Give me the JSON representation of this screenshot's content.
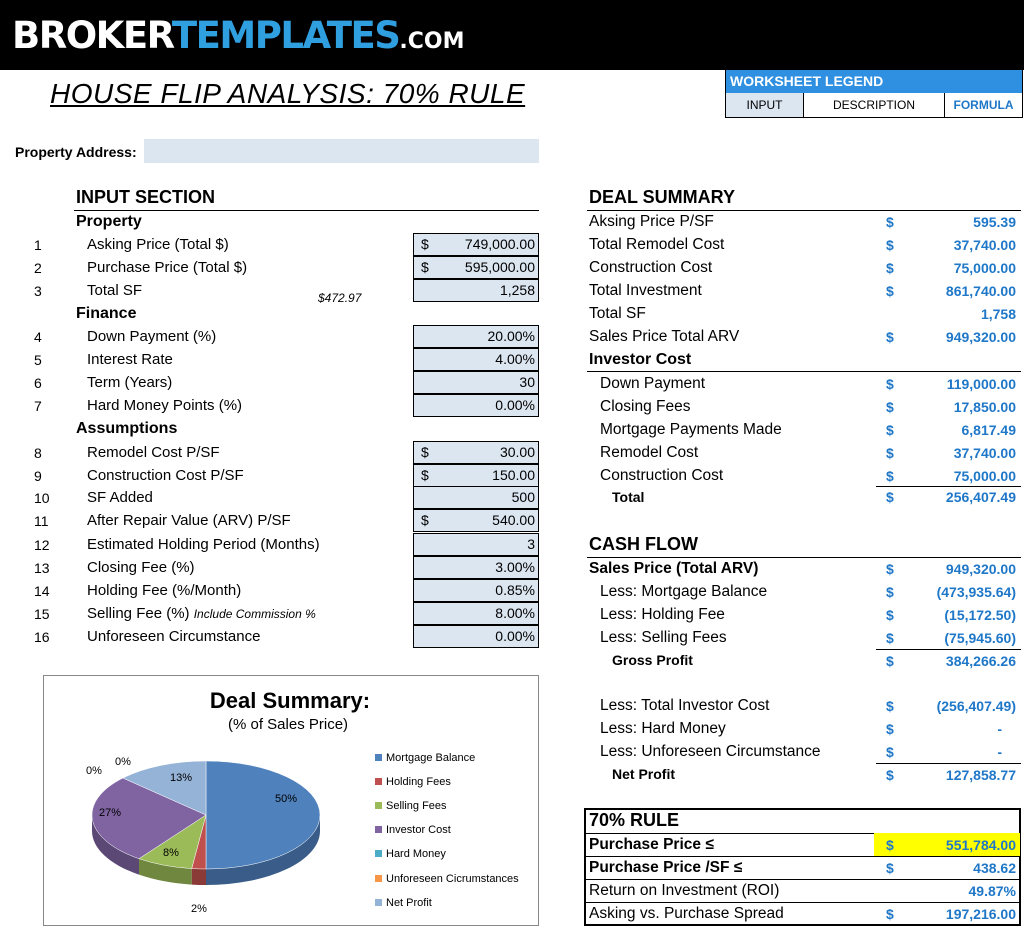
{
  "brand": {
    "part1": "BROKER",
    "part2": "TEMPLATES",
    "part3": ".COM"
  },
  "page_title": "HOUSE FLIP ANALYSIS: 70% RULE",
  "legend": {
    "title": "WORKSHEET LEGEND",
    "input": "INPUT",
    "description": "DESCRIPTION",
    "formula": "FORMULA"
  },
  "property_address": {
    "label": "Property Address:",
    "value": ""
  },
  "input_section": {
    "title": "INPUT SECTION",
    "sub_property": "Property",
    "sub_finance": "Finance",
    "sub_assumptions": "Assumptions",
    "purchase_per_sf_note": "$472.97",
    "rows": [
      {
        "num": "1",
        "label": "Asking Price (Total $)",
        "note": "",
        "currency": "$",
        "value": "749,000.00"
      },
      {
        "num": "2",
        "label": "Purchase Price (Total $)",
        "note": "",
        "currency": "$",
        "value": "595,000.00"
      },
      {
        "num": "3",
        "label": "Total SF",
        "note": "",
        "currency": "",
        "value": "1,258"
      },
      {
        "num": "4",
        "label": "Down Payment (%)",
        "note": "",
        "currency": "",
        "value": "20.00%"
      },
      {
        "num": "5",
        "label": "Interest Rate",
        "note": "",
        "currency": "",
        "value": "4.00%"
      },
      {
        "num": "6",
        "label": "Term (Years)",
        "note": "",
        "currency": "",
        "value": "30"
      },
      {
        "num": "7",
        "label": "Hard Money Points (%)",
        "note": "",
        "currency": "",
        "value": "0.00%"
      },
      {
        "num": "8",
        "label": "Remodel Cost P/SF",
        "note": "",
        "currency": "$",
        "value": "30.00"
      },
      {
        "num": "9",
        "label": "Construction Cost P/SF",
        "note": "",
        "currency": "$",
        "value": "150.00"
      },
      {
        "num": "10",
        "label": "SF Added",
        "note": "",
        "currency": "",
        "value": "500"
      },
      {
        "num": "11",
        "label": "After Repair Value (ARV) P/SF",
        "note": "",
        "currency": "$",
        "value": "540.00"
      },
      {
        "num": "12",
        "label": "Estimated Holding Period (Months)",
        "note": "",
        "currency": "",
        "value": "3"
      },
      {
        "num": "13",
        "label": "Closing Fee (%)",
        "note": "",
        "currency": "",
        "value": "3.00%"
      },
      {
        "num": "14",
        "label": "Holding Fee (%/Month)",
        "note": "",
        "currency": "",
        "value": "0.85%"
      },
      {
        "num": "15",
        "label": "Selling Fee (%) ",
        "note": "Include Commission %",
        "currency": "",
        "value": "8.00%"
      },
      {
        "num": "16",
        "label": "Unforeseen Circumstance",
        "note": "",
        "currency": "",
        "value": "0.00%"
      }
    ]
  },
  "deal_summary": {
    "title": "DEAL SUMMARY",
    "rows": [
      {
        "label": "Aksing Price P/SF",
        "dollar": "$",
        "value": "595.39"
      },
      {
        "label": "Total Remodel Cost",
        "dollar": "$",
        "value": "37,740.00"
      },
      {
        "label": "Construction Cost",
        "dollar": "$",
        "value": "75,000.00"
      },
      {
        "label": "Total Investment",
        "dollar": "$",
        "value": "861,740.00"
      },
      {
        "label": "Total SF",
        "dollar": "",
        "value": "1,758"
      },
      {
        "label": "Sales Price Total ARV",
        "dollar": "$",
        "value": "949,320.00"
      }
    ],
    "investor_title": "Investor Cost",
    "investor_rows": [
      {
        "label": "Down Payment",
        "dollar": "$",
        "value": "119,000.00"
      },
      {
        "label": "Closing Fees",
        "dollar": "$",
        "value": "17,850.00"
      },
      {
        "label": "Mortgage Payments Made",
        "dollar": "$",
        "value": "6,817.49"
      },
      {
        "label": "Remodel Cost",
        "dollar": "$",
        "value": "37,740.00"
      },
      {
        "label": "Construction Cost",
        "dollar": "$",
        "value": "75,000.00"
      }
    ],
    "total_label": "Total",
    "total_dollar": "$",
    "total_value": "256,407.49"
  },
  "cash_flow": {
    "title": "CASH FLOW",
    "sales_label": "Sales Price (Total ARV)",
    "sales_dollar": "$",
    "sales_value": "949,320.00",
    "less_mortgage_label": "Less: Mortgage Balance",
    "less_mortgage_dollar": "$",
    "less_mortgage_value": "(473,935.64)",
    "less_holding_label": "Less: Holding Fee",
    "less_holding_dollar": "$",
    "less_holding_value": "(15,172.50)",
    "less_selling_label": "Less: Selling Fees",
    "less_selling_dollar": "$",
    "less_selling_value": "(75,945.60)",
    "gross_label": "Gross Profit",
    "gross_dollar": "$",
    "gross_value": "384,266.26",
    "less_investor_label": "Less: Total Investor Cost",
    "less_investor_dollar": "$",
    "less_investor_value": "(256,407.49)",
    "less_hard_label": "Less: Hard Money",
    "less_hard_dollar": "$",
    "less_hard_value": "-",
    "less_unforeseen_label": "Less: Unforeseen Circumstance",
    "less_unforeseen_dollar": "$",
    "less_unforeseen_value": "-",
    "net_label": "Net Profit",
    "net_dollar": "$",
    "net_value": "127,858.77"
  },
  "rule": {
    "title": "70% RULE",
    "pp_label": "Purchase Price ≤",
    "pp_dollar": "$",
    "pp_value": "551,784.00",
    "ppsf_label": "Purchase Price /SF ≤",
    "ppsf_dollar": "$",
    "ppsf_value": "438.62",
    "roi_label": "Return on Investment (ROI)",
    "roi_value": "49.87%",
    "spread_label": "Asking vs. Purchase Spread",
    "spread_dollar": "$",
    "spread_value": "197,216.00"
  },
  "chart_data": {
    "type": "pie",
    "title": "Deal Summary:",
    "subtitle": "(% of Sales Price)",
    "categories": [
      "Mortgage Balance",
      "Holding Fees",
      "Selling Fees",
      "Investor Cost",
      "Hard Money",
      "Unforeseen Cicrumstances",
      "Net Profit"
    ],
    "values": [
      50,
      2,
      8,
      27,
      0,
      0,
      13
    ],
    "labels": [
      "50%",
      "2%",
      "8%",
      "27%",
      "0%",
      "0%",
      "13%"
    ],
    "colors": [
      "#4f81bd",
      "#c0504d",
      "#9bbb59",
      "#8064a2",
      "#4bacc6",
      "#f79646",
      "#95b3d7"
    ],
    "legend_position": "right"
  }
}
